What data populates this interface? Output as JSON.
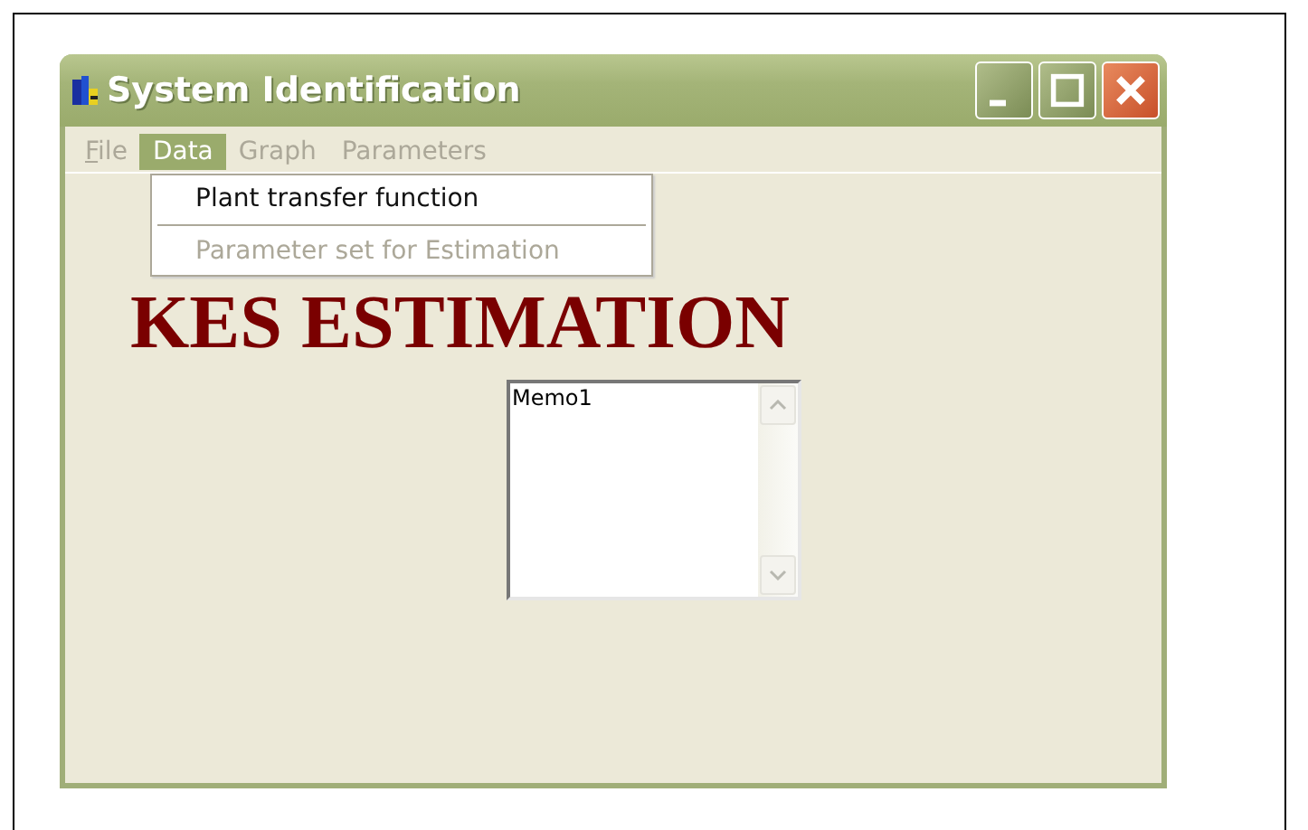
{
  "window": {
    "title": "System Identification"
  },
  "menu": [
    {
      "label": "File",
      "underlined_first": true,
      "selected": false,
      "disabled": true
    },
    {
      "label": "Data",
      "selected": true,
      "disabled": false
    },
    {
      "label": "Graph",
      "selected": false,
      "disabled": true
    },
    {
      "label": "Parameters",
      "selected": false,
      "disabled": true
    }
  ],
  "dropdown": [
    {
      "kind": "item",
      "label": "Plant transfer function",
      "disabled": false
    },
    {
      "kind": "separator"
    },
    {
      "kind": "item",
      "label": "Parameter set for Estimation",
      "disabled": true
    }
  ],
  "heading": "KES ESTIMATION",
  "memo": {
    "value": "Memo1"
  }
}
